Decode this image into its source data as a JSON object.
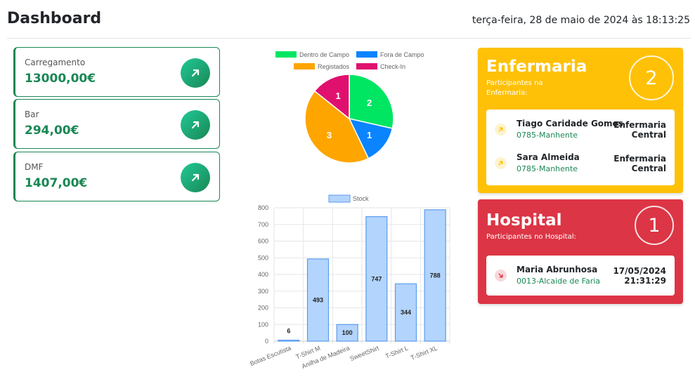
{
  "header": {
    "title": "Dashboard",
    "datetime": "terça-feira, 28 de maio de 2024 às 18:13:25"
  },
  "stats": [
    {
      "label": "Carregamento",
      "value": "13000,00€",
      "icon": "arrow-up-right-icon"
    },
    {
      "label": "Bar",
      "value": "294,00€",
      "icon": "arrow-up-right-icon"
    },
    {
      "label": "DMF",
      "value": "1407,00€",
      "icon": "arrow-up-right-icon"
    }
  ],
  "chart_data": [
    {
      "type": "pie",
      "legend": [
        "Dentro de Campo",
        "Fora de Campo",
        "Registados",
        "Check-In"
      ],
      "values": [
        2,
        1,
        3,
        1
      ],
      "colors": [
        "#00e663",
        "#0a84ff",
        "#ffa500",
        "#e0116e"
      ],
      "legend_position": "top"
    },
    {
      "type": "bar",
      "legend": [
        "Stock"
      ],
      "categories": [
        "Botas Escutista",
        "T-Shirt M",
        "Anilha de Madeira",
        "SweetShirt",
        "T-Shirt L",
        "T-Shirt XL"
      ],
      "values": [
        6,
        493,
        100,
        747,
        344,
        788
      ],
      "ylim": [
        0,
        800
      ],
      "yticks": [
        0,
        100,
        200,
        300,
        400,
        500,
        600,
        700,
        800
      ],
      "grid": true,
      "legend_position": "top",
      "bar_color": "#b3d4fc",
      "bar_border": "#5b9cf0"
    }
  ],
  "enfermaria": {
    "title": "Enfermaria",
    "subtitle": "Participantes na Enfermaria:",
    "count": "2",
    "color": "#ffc107",
    "entries": [
      {
        "name": "Tiago Caridade Gomes",
        "team": "0785-Manhente",
        "location": "Enfermaria Central",
        "icon": "arrow-up-right-icon"
      },
      {
        "name": "Sara Almeida",
        "team": "0785-Manhente",
        "location": "Enfermaria Central",
        "icon": "arrow-up-right-icon"
      }
    ]
  },
  "hospital": {
    "title": "Hospital",
    "subtitle": "Participantes no Hospital:",
    "count": "1",
    "color": "#dc3545",
    "entries": [
      {
        "name": "Maria Abrunhosa",
        "team": "0013-Alcaide de Faria",
        "date": "17/05/2024",
        "time": "21:31:29",
        "icon": "arrow-down-right-icon"
      }
    ]
  }
}
